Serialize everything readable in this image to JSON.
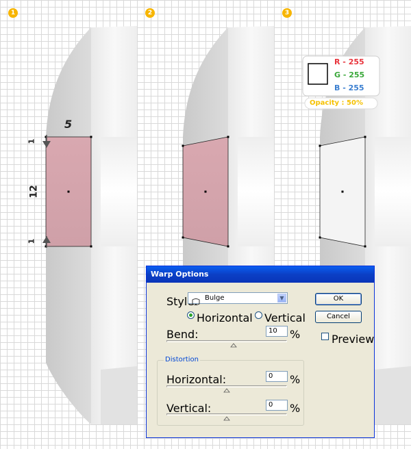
{
  "steps": [
    "1",
    "2",
    "3"
  ],
  "measurements": {
    "width": "5",
    "top_gap": "1",
    "height": "12",
    "bottom_gap": "1"
  },
  "color_card": {
    "r_label": "R - 255",
    "g_label": "G - 255",
    "b_label": "B - 255",
    "opacity_label": "Opacity : 50%",
    "r_color": "#e8343c",
    "g_color": "#3aa83a",
    "b_color": "#3b7fd0",
    "opacity_color": "#f5c100"
  },
  "dialog": {
    "title": "Warp Options",
    "style_label": "Style:",
    "style_value": "Bulge",
    "style_icon": "bulge-icon",
    "horizontal_label": "Horizontal",
    "vertical_label": "Vertical",
    "selected_orientation": "Horizontal",
    "bend_label": "Bend:",
    "bend_value": "10",
    "percent": "%",
    "distortion_label": "Distortion",
    "dist_horizontal_label": "Horizontal:",
    "dist_horizontal_value": "0",
    "dist_vertical_label": "Vertical:",
    "dist_vertical_value": "0",
    "ok_label": "OK",
    "cancel_label": "Cancel",
    "preview_label": "Preview",
    "preview_checked": false
  },
  "colors": {
    "rect_fill": "#d4a3ab",
    "dialog_title_bar": "#0b3fc5",
    "badge": "#f7b500"
  }
}
